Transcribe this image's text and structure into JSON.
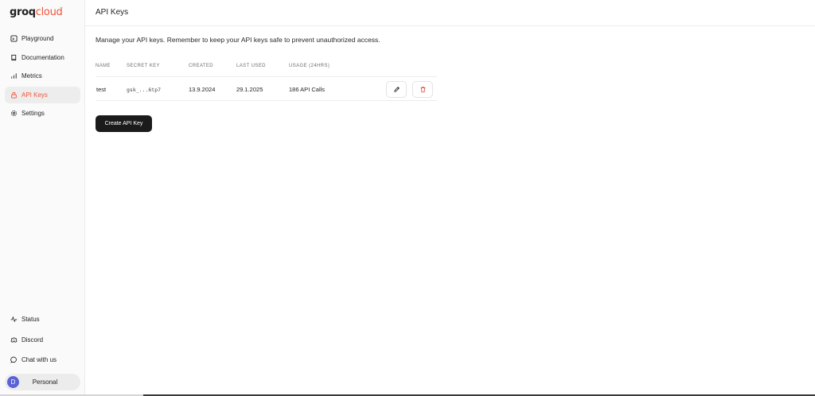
{
  "brand": {
    "part1": "groq",
    "part2": "cloud",
    "accent": "#f0533b"
  },
  "sidebar": {
    "items": [
      {
        "label": "Playground",
        "icon": "playground-icon",
        "active": false
      },
      {
        "label": "Documentation",
        "icon": "book-icon",
        "active": false
      },
      {
        "label": "Metrics",
        "icon": "bar-chart-icon",
        "active": false
      },
      {
        "label": "API Keys",
        "icon": "lock-icon",
        "active": true
      },
      {
        "label": "Settings",
        "icon": "gear-icon",
        "active": false
      }
    ],
    "bottom_items": [
      {
        "label": "Status",
        "icon": "activity-icon"
      },
      {
        "label": "Discord",
        "icon": "discord-icon"
      },
      {
        "label": "Chat with us",
        "icon": "chat-icon"
      }
    ],
    "account": {
      "initial": "D",
      "label": "Personal"
    }
  },
  "header": {
    "title": "API Keys"
  },
  "main": {
    "description": "Manage your API keys. Remember to keep your API keys safe to prevent unauthorized access.",
    "table": {
      "columns": [
        "NAME",
        "SECRET KEY",
        "CREATED",
        "LAST USED",
        "USAGE (24HRS)"
      ],
      "rows": [
        {
          "name": "test",
          "secret": "gsk_...6tp7",
          "created": "13.9.2024",
          "last_used": "29.1.2025",
          "usage": "186 API Calls"
        }
      ]
    },
    "create_button": "Create API Key"
  }
}
